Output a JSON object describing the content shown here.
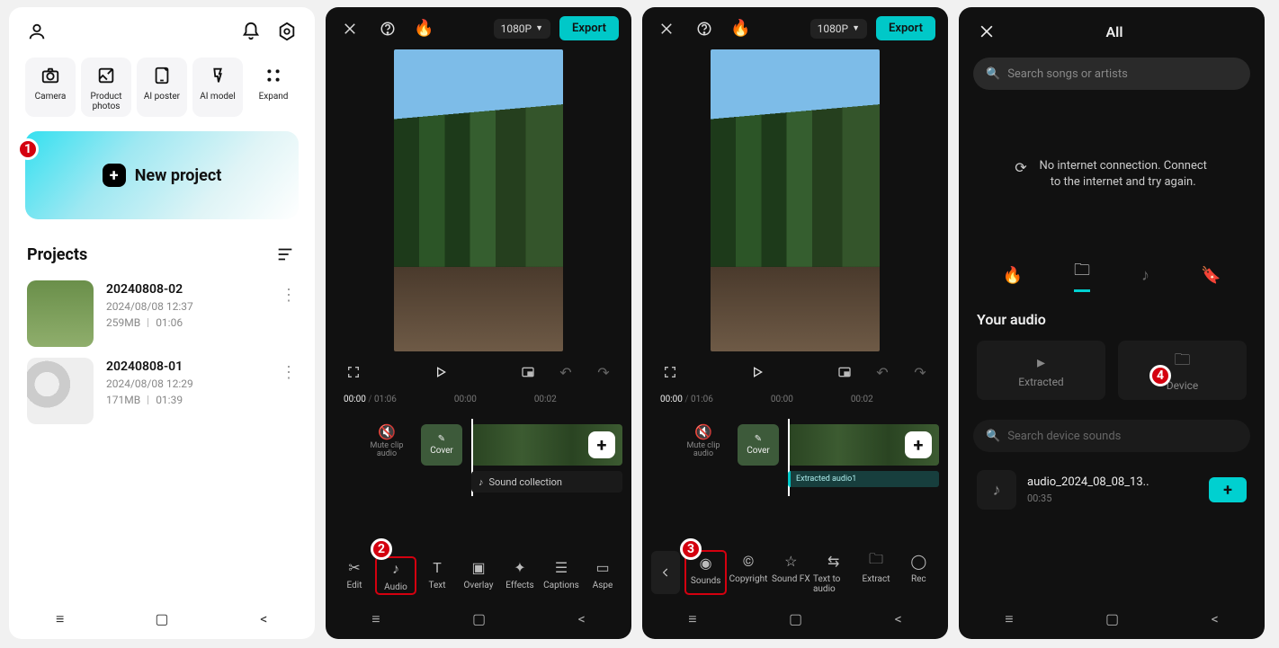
{
  "screen1": {
    "tools": [
      {
        "label": "Camera"
      },
      {
        "label": "Product\nphotos"
      },
      {
        "label": "AI poster"
      },
      {
        "label": "AI model"
      },
      {
        "label": "Expand"
      }
    ],
    "new_project_label": "New project",
    "projects_title": "Projects",
    "projects": [
      {
        "name": "20240808-02",
        "date": "2024/08/08 12:37",
        "size": "259MB",
        "dur": "01:06"
      },
      {
        "name": "20240808-01",
        "date": "2024/08/08 12:29",
        "size": "171MB",
        "dur": "01:39"
      }
    ],
    "badge": "1"
  },
  "editor": {
    "resolution": "1080P",
    "export_label": "Export",
    "time_current": "00:00",
    "time_total": "01:06",
    "ticks": [
      "00:00",
      "00:02"
    ],
    "mute_label": "Mute clip audio",
    "cover_label": "Cover",
    "sound_collection_label": "Sound collection",
    "extracted_label": "Extracted audio1"
  },
  "bottom2": [
    {
      "label": "Edit"
    },
    {
      "label": "Audio"
    },
    {
      "label": "Text"
    },
    {
      "label": "Overlay"
    },
    {
      "label": "Effects"
    },
    {
      "label": "Captions"
    },
    {
      "label": "Aspe"
    }
  ],
  "badge2": "2",
  "bottom3": [
    {
      "label": "Sounds"
    },
    {
      "label": "Copyright"
    },
    {
      "label": "Sound FX"
    },
    {
      "label": "Text to audio"
    },
    {
      "label": "Extract"
    },
    {
      "label": "Rec"
    }
  ],
  "badge3": "3",
  "screen4": {
    "title": "All",
    "search_placeholder": "Search songs or artists",
    "no_net": "No internet connection. Connect to the internet and try again.",
    "your_audio": "Your audio",
    "cards": [
      {
        "label": "Extracted"
      },
      {
        "label": "Device"
      }
    ],
    "search2_placeholder": "Search device sounds",
    "audio": {
      "name": "audio_2024_08_08_13..",
      "dur": "00:35"
    },
    "badge": "4"
  }
}
